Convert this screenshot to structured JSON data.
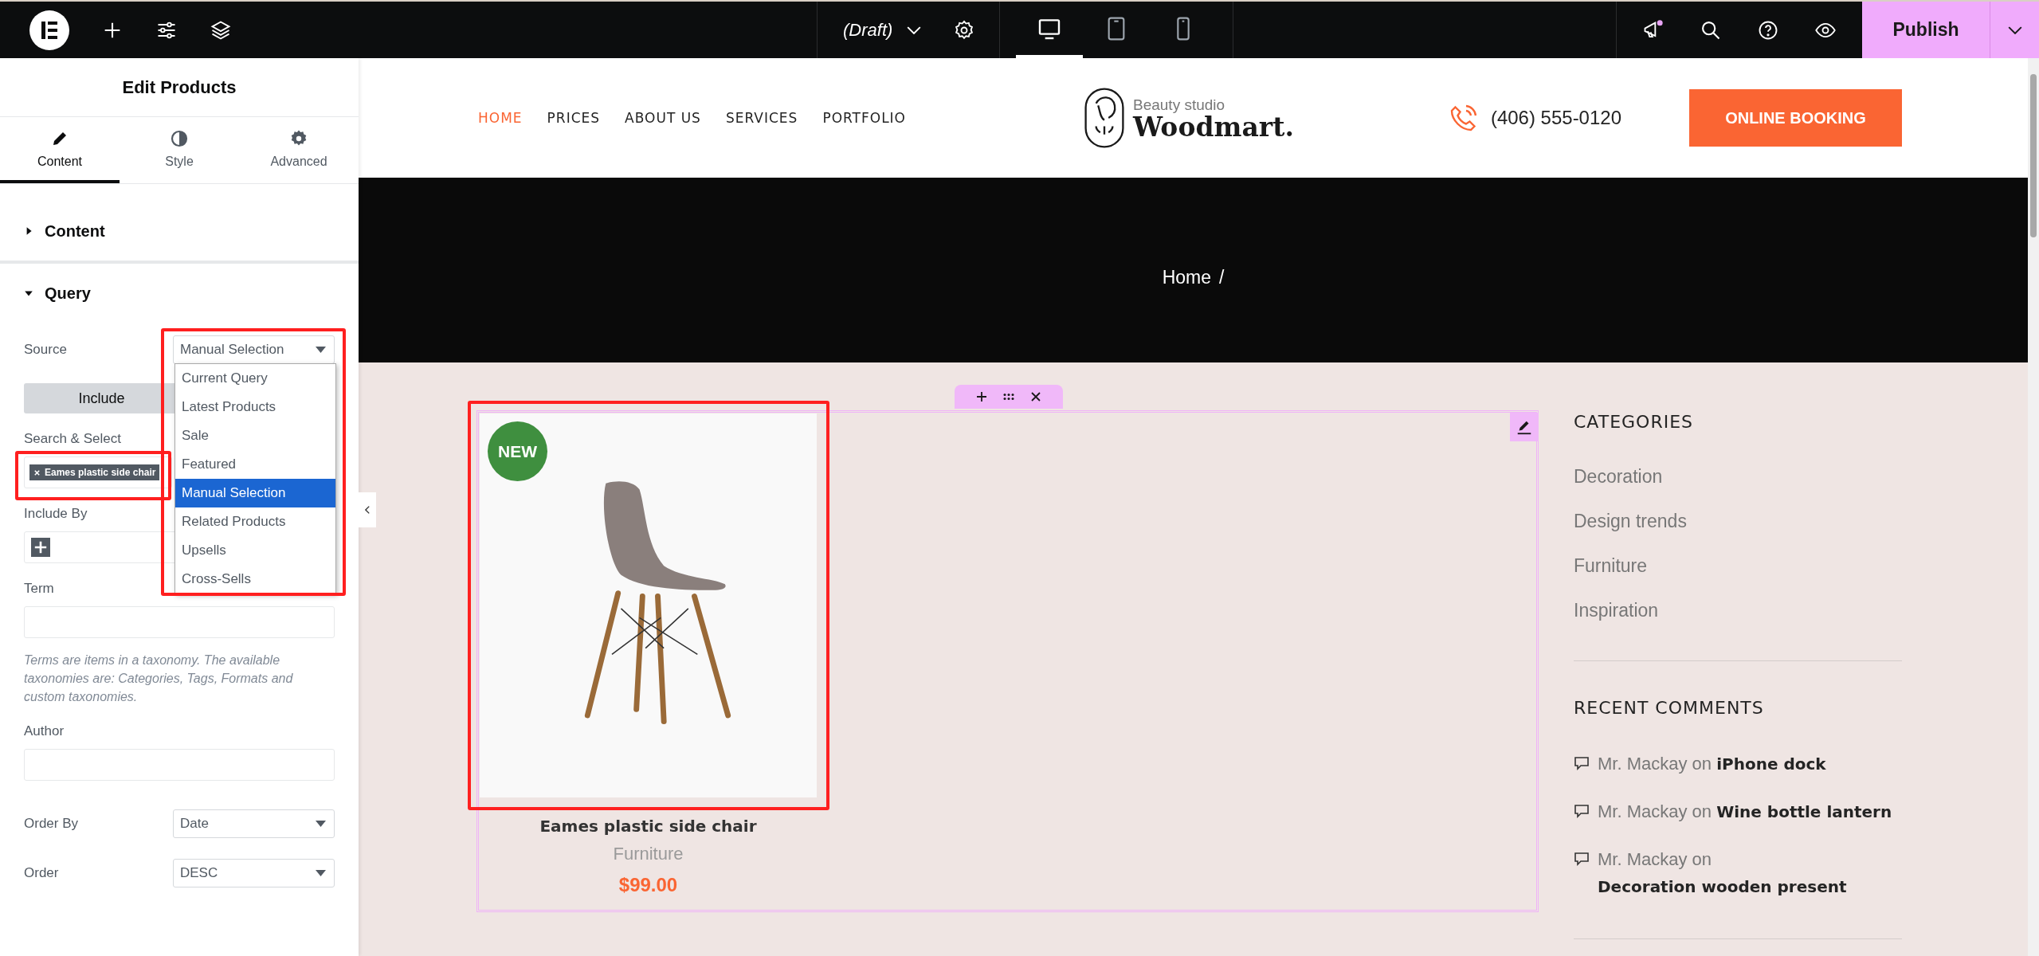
{
  "top_bar": {
    "document_status": "(Draft)",
    "devices": [
      {
        "kind": "desktop",
        "selected": true
      },
      {
        "kind": "tablet",
        "selected": false
      },
      {
        "kind": "mobile",
        "selected": false
      }
    ],
    "publish_button": "Publish"
  },
  "panel": {
    "title": "Edit Products",
    "tabs": [
      {
        "kind": "pencil",
        "label": "Content",
        "selected": true
      },
      {
        "kind": "contrast",
        "label": "Style",
        "selected": false
      },
      {
        "kind": "gear",
        "label": "Advanced",
        "selected": false
      }
    ],
    "sections": [
      {
        "title": "Content",
        "expanded": false
      },
      {
        "title": "Query",
        "expanded": true
      }
    ],
    "query": {
      "source": {
        "label": "Source",
        "value": "Manual Selection",
        "open": true,
        "options": [
          {
            "label": "Current Query",
            "selected": false
          },
          {
            "label": "Latest Products",
            "selected": false
          },
          {
            "label": "Sale",
            "selected": false
          },
          {
            "label": "Featured",
            "selected": false
          },
          {
            "label": "Manual Selection",
            "selected": true
          },
          {
            "label": "Related Products",
            "selected": false
          },
          {
            "label": "Upsells",
            "selected": false
          },
          {
            "label": "Cross-Sells",
            "selected": false
          }
        ]
      },
      "include_button": "Include",
      "search_label": "Search & Select",
      "selected_products": [
        "Eames plastic side chair"
      ],
      "include_by_label": "Include By",
      "term": {
        "label": "Term",
        "help": "Terms are items in a taxonomy. The available taxonomies are: Categories, Tags, Formats and custom taxonomies."
      },
      "author_label": "Author",
      "order_by": {
        "label": "Order By",
        "value": "Date"
      },
      "order": {
        "label": "Order",
        "value": "DESC"
      }
    }
  },
  "site": {
    "nav": [
      {
        "label": "HOME",
        "selected": true
      },
      {
        "label": "PRICES",
        "selected": false
      },
      {
        "label": "ABOUT US",
        "selected": false
      },
      {
        "label": "SERVICES",
        "selected": false
      },
      {
        "label": "PORTFOLIO",
        "selected": false
      }
    ],
    "logo": {
      "tagline": "Beauty studio",
      "name": "Woodmart."
    },
    "phone": "(406) 555-0120",
    "booking_button": "ONLINE BOOKING",
    "breadcrumb": {
      "items": [
        "Home"
      ],
      "separator": "/"
    },
    "product": {
      "badge": "NEW",
      "title": "Eames plastic side chair",
      "category": "Furniture",
      "price": "$99.00"
    },
    "sidebar": {
      "categories_title": "CATEGORIES",
      "categories": [
        "Decoration",
        "Design trends",
        "Furniture",
        "Inspiration"
      ],
      "comments_title": "RECENT COMMENTS",
      "comments": [
        {
          "author": "Mr. Mackay",
          "joiner": "on",
          "post": "iPhone dock"
        },
        {
          "author": "Mr. Mackay",
          "joiner": "on",
          "post": "Wine bottle lantern"
        },
        {
          "author": "Mr. Mackay",
          "joiner": "on",
          "post": "Decoration wooden present"
        }
      ]
    }
  }
}
